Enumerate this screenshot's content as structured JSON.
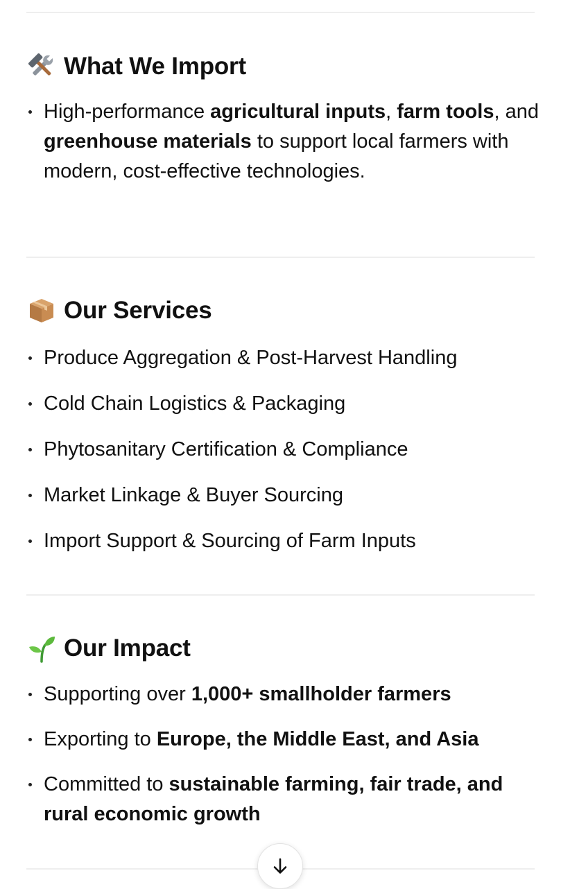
{
  "import_section": {
    "emoji_icon": "hammer-and-wrench-icon",
    "title": "What We Import",
    "item": {
      "t1": "High-performance ",
      "b1": "agricultural inputs",
      "t2": ", ",
      "b2": "farm tools",
      "t3": ", and ",
      "b3": "greenhouse materials",
      "t4": " to support local farmers with modern, cost-effective technologies."
    }
  },
  "services_section": {
    "emoji_icon": "package-icon",
    "title": "Our Services",
    "items": [
      "Produce Aggregation & Post-Harvest Handling",
      "Cold Chain Logistics & Packaging",
      "Phytosanitary Certification & Compliance",
      "Market Linkage & Buyer Sourcing",
      "Import Support & Sourcing of Farm Inputs"
    ]
  },
  "impact_section": {
    "emoji_icon": "seedling-icon",
    "title": "Our Impact",
    "items": [
      {
        "text": "Supporting over ",
        "bold": "1,000+ smallholder farmers"
      },
      {
        "text": "Exporting to ",
        "bold": "Europe, the Middle East, and Asia"
      },
      {
        "text": "Committed to ",
        "bold": "sustainable farming, fair trade, and rural economic growth"
      }
    ]
  },
  "scroll_button": {
    "icon": "arrow-down-icon"
  }
}
